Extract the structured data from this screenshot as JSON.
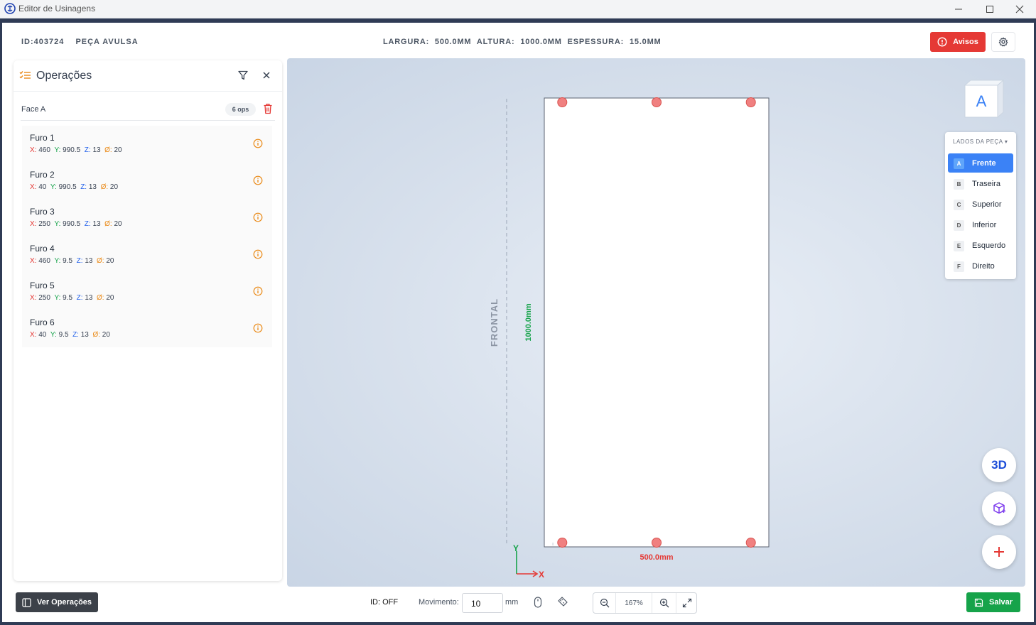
{
  "window": {
    "title": "Editor de Usinagens",
    "controls": [
      "minimize",
      "maximize",
      "close"
    ]
  },
  "header": {
    "id": "ID:403724",
    "piece_type": "PEÇA AVULSA",
    "largura_label": "LARGURA:",
    "largura_value": "500.0MM",
    "altura_label": "ALTURA:",
    "altura_value": "1000.0MM",
    "espessura_label": "ESPESSURA:",
    "espessura_value": "15.0MM",
    "avisos_label": "Avisos",
    "accent_red": "#e53935"
  },
  "operations": {
    "title": "Operações",
    "face_label": "Face A",
    "ops_badge": "6 ops",
    "items": [
      {
        "name": "Furo 1",
        "x": "460",
        "y": "990.5",
        "z": "13",
        "d": "20"
      },
      {
        "name": "Furo 2",
        "x": "40",
        "y": "990.5",
        "z": "13",
        "d": "20"
      },
      {
        "name": "Furo 3",
        "x": "250",
        "y": "990.5",
        "z": "13",
        "d": "20"
      },
      {
        "name": "Furo 4",
        "x": "460",
        "y": "9.5",
        "z": "13",
        "d": "20"
      },
      {
        "name": "Furo 5",
        "x": "250",
        "y": "9.5",
        "z": "13",
        "d": "20"
      },
      {
        "name": "Furo 6",
        "x": "40",
        "y": "9.5",
        "z": "13",
        "d": "20"
      }
    ],
    "labels": {
      "x": "X:",
      "y": "Y:",
      "z": "Z:",
      "d": "Ø:"
    }
  },
  "canvas": {
    "frontal_label": "FRONTAL",
    "height_label": "1000.0mm",
    "width_label": "500.0mm",
    "axis_y": "Y",
    "axis_x": "X",
    "cube_face": "A",
    "piece_width_mm": 500,
    "piece_height_mm": 1000,
    "hole_color": "#f08080"
  },
  "sides": {
    "title": "LADOS DA PEÇA",
    "items": [
      {
        "letter": "A",
        "name": "Frente",
        "active": true
      },
      {
        "letter": "B",
        "name": "Traseira",
        "active": false
      },
      {
        "letter": "C",
        "name": "Superior",
        "active": false
      },
      {
        "letter": "D",
        "name": "Inferior",
        "active": false
      },
      {
        "letter": "E",
        "name": "Esquerdo",
        "active": false
      },
      {
        "letter": "F",
        "name": "Direito",
        "active": false
      }
    ]
  },
  "fabs": {
    "three_d": "3D"
  },
  "bottom": {
    "ver_operacoes": "Ver Operações",
    "id_toggle": "ID: OFF",
    "movimento_label": "Movimento:",
    "movimento_value": "10",
    "unit": "mm",
    "zoom": "167%",
    "salvar": "Salvar"
  }
}
